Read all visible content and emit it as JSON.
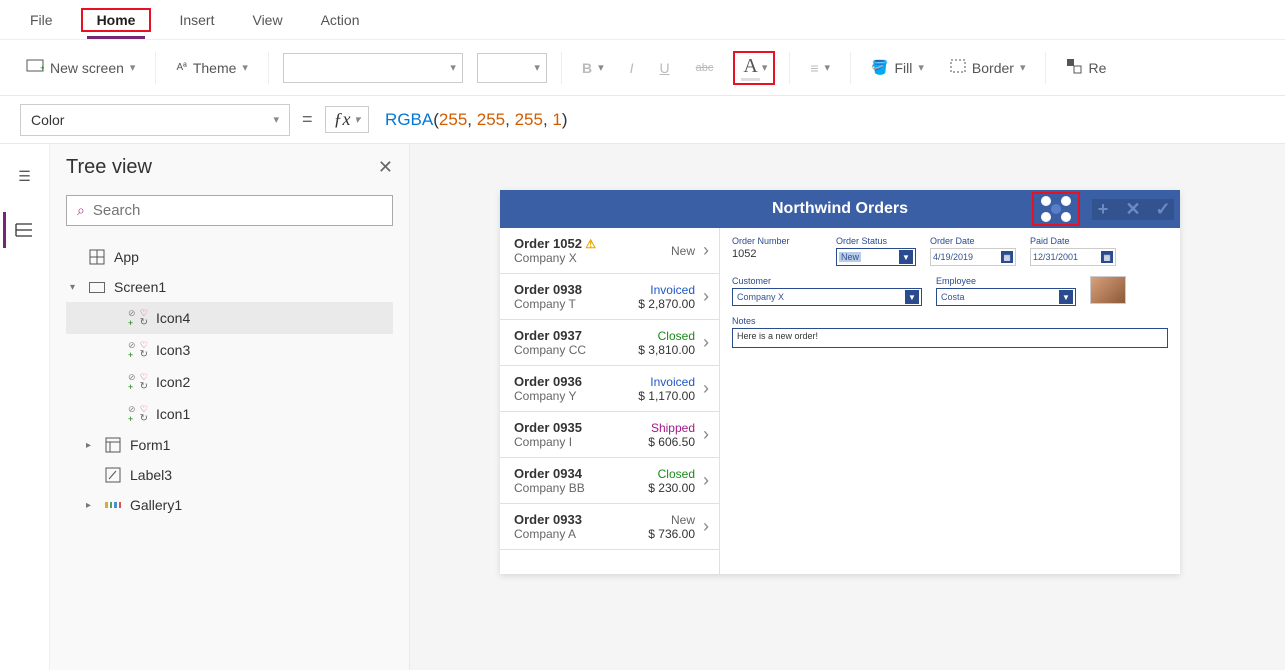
{
  "menubar": {
    "items": [
      "File",
      "Home",
      "Insert",
      "View",
      "Action"
    ],
    "active": "Home"
  },
  "toolbar": {
    "new_screen": "New screen",
    "theme": "Theme",
    "fill": "Fill",
    "border": "Border",
    "reorder": "Re"
  },
  "formula": {
    "property": "Color",
    "fn": "RGBA",
    "args": [
      "255",
      "255",
      "255",
      "1"
    ]
  },
  "tree": {
    "title": "Tree view",
    "search_placeholder": "Search",
    "app_label": "App",
    "screen_label": "Screen1",
    "items": [
      "Icon4",
      "Icon3",
      "Icon2",
      "Icon1",
      "Form1",
      "Label3",
      "Gallery1"
    ],
    "selected": "Icon4"
  },
  "app": {
    "title": "Northwind Orders",
    "orders": [
      {
        "title": "Order 1052",
        "company": "Company X",
        "status": "New",
        "status_class": "st-new",
        "amount": "",
        "warn": true
      },
      {
        "title": "Order 0938",
        "company": "Company T",
        "status": "Invoiced",
        "status_class": "st-invoiced",
        "amount": "$ 2,870.00"
      },
      {
        "title": "Order 0937",
        "company": "Company CC",
        "status": "Closed",
        "status_class": "st-closed",
        "amount": "$ 3,810.00"
      },
      {
        "title": "Order 0936",
        "company": "Company Y",
        "status": "Invoiced",
        "status_class": "st-invoiced",
        "amount": "$ 1,170.00"
      },
      {
        "title": "Order 0935",
        "company": "Company I",
        "status": "Shipped",
        "status_class": "st-shipped",
        "amount": "$ 606.50"
      },
      {
        "title": "Order 0934",
        "company": "Company BB",
        "status": "Closed",
        "status_class": "st-closed",
        "amount": "$ 230.00"
      },
      {
        "title": "Order 0933",
        "company": "Company A",
        "status": "New",
        "status_class": "st-new",
        "amount": "$ 736.00"
      }
    ],
    "form": {
      "order_number_label": "Order Number",
      "order_number": "1052",
      "order_status_label": "Order Status",
      "order_status": "New",
      "order_date_label": "Order Date",
      "order_date": "4/19/2019",
      "paid_date_label": "Paid Date",
      "paid_date": "12/31/2001",
      "customer_label": "Customer",
      "customer": "Company X",
      "employee_label": "Employee",
      "employee": "Costa",
      "notes_label": "Notes",
      "notes": "Here is a new order!"
    }
  }
}
